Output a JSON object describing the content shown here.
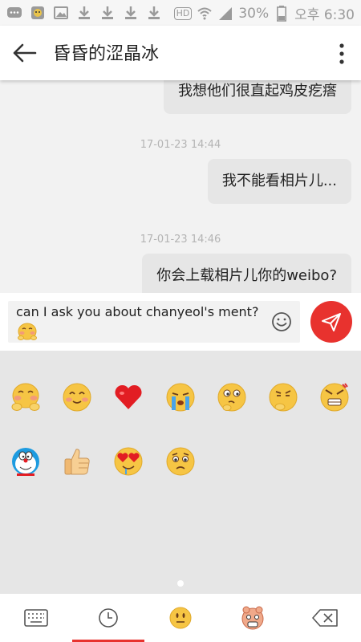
{
  "status_bar": {
    "hd": "HD",
    "battery": "30%",
    "time": "오후 6:30"
  },
  "header": {
    "title": "昏昏的涩晶冰"
  },
  "messages": [
    {
      "text": "我想他们很直起鸡皮疙瘩"
    },
    {
      "timestamp": "17-01-23 14:44"
    },
    {
      "text": "我不能看相片儿..."
    },
    {
      "timestamp": "17-01-23 14:46"
    },
    {
      "text": "你会上载相片儿你的weibo?"
    }
  ],
  "composer": {
    "input_value": "can I ask you about chanyeol's ment?"
  },
  "emoji_grid": [
    "shy-face",
    "smile-face",
    "heart",
    "crying-face",
    "thinking-face",
    "pondering-face",
    "angry-face",
    "doraemon",
    "thumbs-up",
    "heart-eyes-face",
    "sad-face"
  ],
  "bottom_tabs": [
    "keyboard",
    "recent",
    "emoji",
    "sticker",
    "backspace"
  ],
  "colors": {
    "accent": "#e8322e",
    "bubble": "#e6e6e6",
    "panel": "#e6e6e6"
  }
}
